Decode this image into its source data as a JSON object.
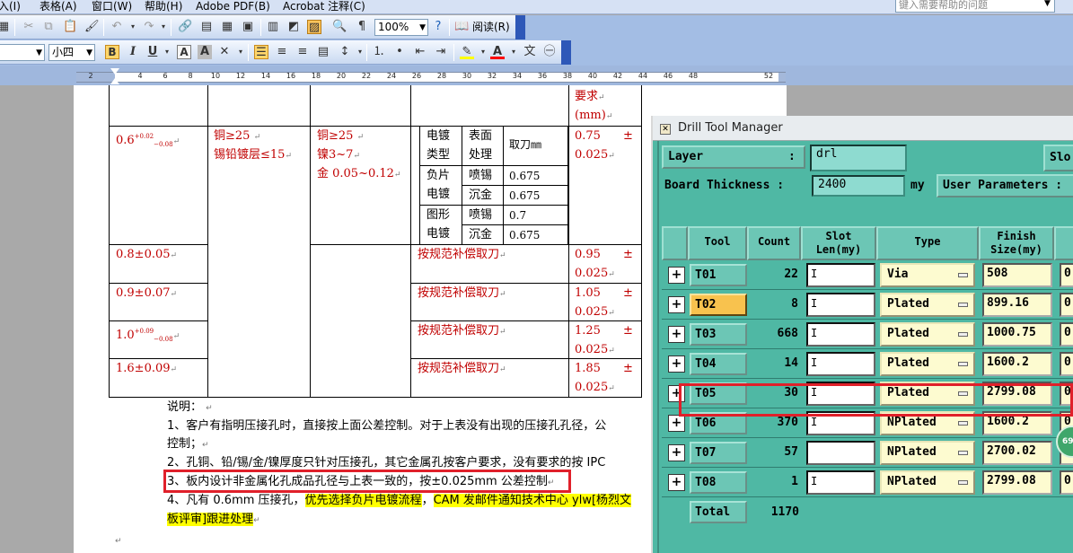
{
  "menu": {
    "items": [
      "入(I)",
      "表格(A)",
      "窗口(W)",
      "帮助(H)",
      "Adobe PDF(B)",
      "Acrobat 注释(C)"
    ],
    "help_placeholder": "键入需要帮助的问题"
  },
  "toolbar": {
    "zoom": "100%",
    "read_label": "阅读(R)",
    "font_size": "小四"
  },
  "ruler": {
    "ticks": [
      "2",
      "2",
      "4",
      "6",
      "8",
      "10",
      "12",
      "14",
      "16",
      "18",
      "20",
      "22",
      "24",
      "26",
      "28",
      "30",
      "32",
      "34",
      "36",
      "38",
      "40",
      "42",
      "44",
      "46",
      "48",
      "52"
    ]
  },
  "table": {
    "top_req": "要求",
    "top_unit": "(mm)",
    "row1": {
      "aperture_main": "0.6",
      "aperture_sup": "+0.02",
      "aperture_sub": "−0.08",
      "copper1": "铜≥25",
      "copper2": "锡铅镀层≤15",
      "nickel1": "铜≥25",
      "nickel2": "镍3~7",
      "nickel3": "金 0.05~0.12",
      "inner": {
        "h_plating": "电镀类型",
        "h_surface": "表面处理",
        "h_drill": "取刀㎜",
        "neg_plating": "负片电镀",
        "pattern_plating": "图形电镀",
        "spray": "喷锡",
        "immersion": "沉金",
        "v1": "0.675",
        "v2": "0.675",
        "v3": "0.7",
        "v4": "0.675"
      },
      "req_value": "0.75",
      "req_tol": "0.025",
      "pm": "±"
    },
    "rows": [
      {
        "aperture": "0.8±0.05",
        "drill": "按规范补偿取刀",
        "req": "0.95",
        "tol": "0.025",
        "pm": "±"
      },
      {
        "aperture": "0.9±0.07",
        "drill": "按规范补偿取刀",
        "req": "1.05",
        "tol": "0.025",
        "pm": "±"
      },
      {
        "aperture": "1.0",
        "ap_sup": "+0.09",
        "ap_sub": "−0.08",
        "drill": "按规范补偿取刀",
        "req": "1.25",
        "tol": "0.025",
        "pm": "±"
      },
      {
        "aperture": "1.6±0.09",
        "drill": "按规范补偿取刀",
        "req": "1.85",
        "tol": "0.025",
        "pm": "±"
      }
    ]
  },
  "notes": {
    "title": "说明：",
    "l1": "1、客户有指明压接孔时，直接按上面公差控制。对于上表没有出现的压接孔孔径，公",
    "l1b": "控制；",
    "l2": "2、孔铜、铅/锡/金/镍厚度只针对压接孔，其它金属孔按客户要求，没有要求的按 IPC",
    "l3": "3、板内设计非金属化孔成品孔径与上表一致的，按±0.025mm 公差控制",
    "l4a": "4、凡有 0.6mm 压接孔，",
    "l4b": "优先选择负片电镀流程",
    "l4c": "，",
    "l4d": "CAM 发邮件通知技术中心 ylw[杨烈文",
    "l5": "板评审]跟进处理"
  },
  "dtm": {
    "title": "Drill Tool Manager",
    "layer_label": "Layer",
    "layer_colon": ":",
    "layer_value": "drl",
    "slot_cut": "Slo",
    "thickness_label": "Board Thickness :",
    "thickness_value": "2400",
    "thickness_unit": "my",
    "user_params": "User Parameters :",
    "headers": {
      "tool": "Tool",
      "count": "Count",
      "slot1": "Slot",
      "slot2": "Len(my)",
      "type": "Type",
      "finish1": "Finish",
      "finish2": "Size(my)"
    },
    "rows": [
      {
        "tool": "T01",
        "count": "22",
        "type": "Via",
        "size": "508",
        "last": "0"
      },
      {
        "tool": "T02",
        "count": "8",
        "type": "Plated",
        "size": "899.16",
        "last": "0"
      },
      {
        "tool": "T03",
        "count": "668",
        "type": "Plated",
        "size": "1000.75",
        "last": "0"
      },
      {
        "tool": "T04",
        "count": "14",
        "type": "Plated",
        "size": "1600.2",
        "last": "0"
      },
      {
        "tool": "T05",
        "count": "30",
        "type": "Plated",
        "size": "2799.08",
        "last": "0"
      },
      {
        "tool": "T06",
        "count": "370",
        "type": "NPlated",
        "size": "1600.2",
        "last": "0"
      },
      {
        "tool": "T07",
        "count": "57",
        "type": "NPlated",
        "size": "2700.02",
        "last": "0"
      },
      {
        "tool": "T08",
        "count": "1",
        "type": "NPlated",
        "size": "2799.08",
        "last": "0"
      }
    ],
    "total_label": "Total",
    "total_value": "1170",
    "badge": "69"
  }
}
